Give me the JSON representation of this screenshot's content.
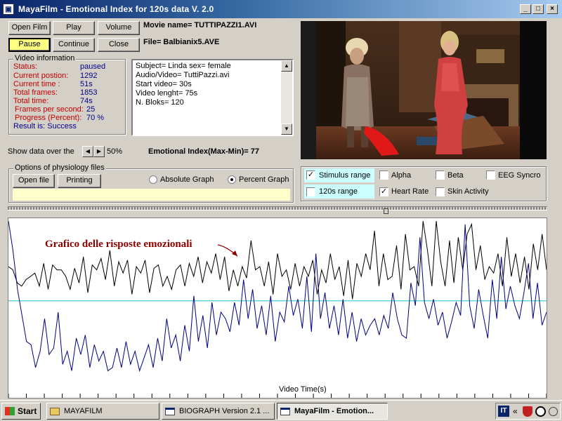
{
  "window": {
    "title": "MayaFilm  -  Emotional Index  for 120s data   V. 2.0",
    "minimize": "_",
    "maximize": "□",
    "close": "×"
  },
  "buttons": {
    "open_film": "Open Film",
    "play": "Play",
    "volume": "Volume",
    "pause": "Pause",
    "continue": "Continue",
    "close": "Close"
  },
  "movie": {
    "name_label": "Movie name=  TUTTIPAZZI1.AVI",
    "file_label": "File=  Balbianix5.AVE"
  },
  "video_info": {
    "title": "Video information",
    "status_label": "Status:",
    "status_value": "paused",
    "position_label": "Current postion:",
    "position_value": "1292",
    "time_label": "Current time :",
    "time_value": "51s",
    "frames_label": "Total frames:",
    "frames_value": "1853",
    "total_time_label": "Total time:",
    "total_time_value": "74s",
    "fps_label": "Frames per second:",
    "fps_value": "25",
    "progress_label": "Progress (Percent):",
    "progress_value": "70 %",
    "result": "Result is: Success"
  },
  "subject_info": {
    "lines": [
      "Subject= Linda    sex=  female",
      "Audio/Video= TuttiPazzi.avi",
      "Start video= 30s",
      "Video lenght= 75s",
      "N. Bloks= 120"
    ]
  },
  "show_data": {
    "label": "Show data over the",
    "value": "50%"
  },
  "emotional_index": "Emotional Index(Max-Min)= 77",
  "physiology": {
    "title": "Options  of  physiology files",
    "open_file": "Open file",
    "printing": "Printing",
    "absolute_graph": "Absolute Graph",
    "percent_graph": "Percent Graph",
    "selected": "percent"
  },
  "checkboxes": [
    {
      "label": "Stimulus range",
      "checked": true
    },
    {
      "label": "Alpha",
      "checked": false
    },
    {
      "label": "Beta",
      "checked": false
    },
    {
      "label": "EEG Syncro",
      "checked": false
    },
    {
      "label": "120s range",
      "checked": false
    },
    {
      "label": "Heart Rate",
      "checked": true
    },
    {
      "label": "Skin Activity",
      "checked": false
    }
  ],
  "graph": {
    "annotation": "Grafico delle risposte emozionali",
    "xlabel": "Video Time(s)"
  },
  "chart_data": {
    "type": "line",
    "xlabel": "Video Time(s)",
    "title": "Grafico delle risposte emozionali",
    "baseline_percent": 51,
    "series": [
      {
        "color": "#000000",
        "values": [
          72,
          70,
          62,
          60,
          64,
          66,
          68,
          60,
          74,
          58,
          73,
          70,
          70,
          66,
          58,
          71,
          62,
          78,
          56,
          73,
          70,
          77,
          64,
          82,
          60,
          75,
          68,
          76,
          55,
          72,
          68,
          76,
          56,
          71,
          73,
          60,
          66,
          58,
          70,
          73,
          60,
          74,
          66,
          78,
          62,
          75,
          68,
          80,
          64,
          78,
          57,
          70,
          60,
          72,
          65,
          88,
          70,
          72,
          60,
          75,
          55,
          80,
          66,
          70,
          58,
          74,
          60,
          72,
          66,
          76,
          55,
          70,
          62,
          80,
          64,
          72,
          54,
          76,
          52,
          74,
          66,
          80,
          70,
          94,
          60,
          80,
          64,
          66,
          85,
          58,
          92,
          70,
          72,
          60,
          100,
          82,
          60,
          100,
          75,
          60,
          88,
          62,
          90,
          70,
          92,
          98,
          70,
          85,
          64,
          72,
          68,
          80,
          60,
          90,
          66,
          80,
          62,
          78,
          58,
          86,
          70,
          92,
          70
        ]
      },
      {
        "color": "#000080",
        "values": [
          100,
          82,
          58,
          42,
          26,
          24,
          10,
          20,
          40,
          18,
          22,
          44,
          12,
          20,
          8,
          28,
          18,
          30,
          10,
          24,
          14,
          20,
          8,
          10,
          22,
          10,
          26,
          12,
          20,
          8,
          16,
          24,
          10,
          28,
          14,
          40,
          22,
          30,
          14,
          36,
          20,
          54,
          26,
          42,
          22,
          50,
          30,
          44,
          40,
          32,
          50,
          36,
          64,
          40,
          58,
          34,
          48,
          30,
          54,
          26,
          44,
          38,
          60,
          42,
          52,
          34,
          66,
          32,
          80,
          40,
          56,
          34,
          48,
          30,
          52,
          28,
          44,
          26,
          40,
          30,
          36,
          40,
          30,
          42,
          34,
          56,
          40,
          30,
          28,
          62,
          48,
          90,
          50,
          40,
          52,
          36,
          44,
          28,
          38,
          50,
          42,
          98,
          48,
          34,
          58,
          42,
          28,
          64,
          40,
          78,
          46,
          60,
          48,
          40,
          56,
          74,
          40,
          62,
          36,
          44
        ]
      }
    ]
  },
  "taskbar": {
    "start": "Start",
    "items": [
      {
        "label": "MAYAFILM",
        "active": false
      },
      {
        "label": "BIOGRAPH   Version 2.1 ...",
        "active": false
      },
      {
        "label": "MayaFilm  -  Emotion...",
        "active": true
      }
    ],
    "lang": "IT",
    "chevron": "«"
  },
  "colors": {
    "titlebar_start": "#0a246a",
    "titlebar_end": "#a6caf0",
    "info_label_red": "#c00000",
    "info_value_blue": "#00008b",
    "annotation_red": "#8b0000",
    "baseline_cyan": "#33cccc",
    "yellow_button": "#ffff80",
    "cyan_box": "#ccffff"
  }
}
